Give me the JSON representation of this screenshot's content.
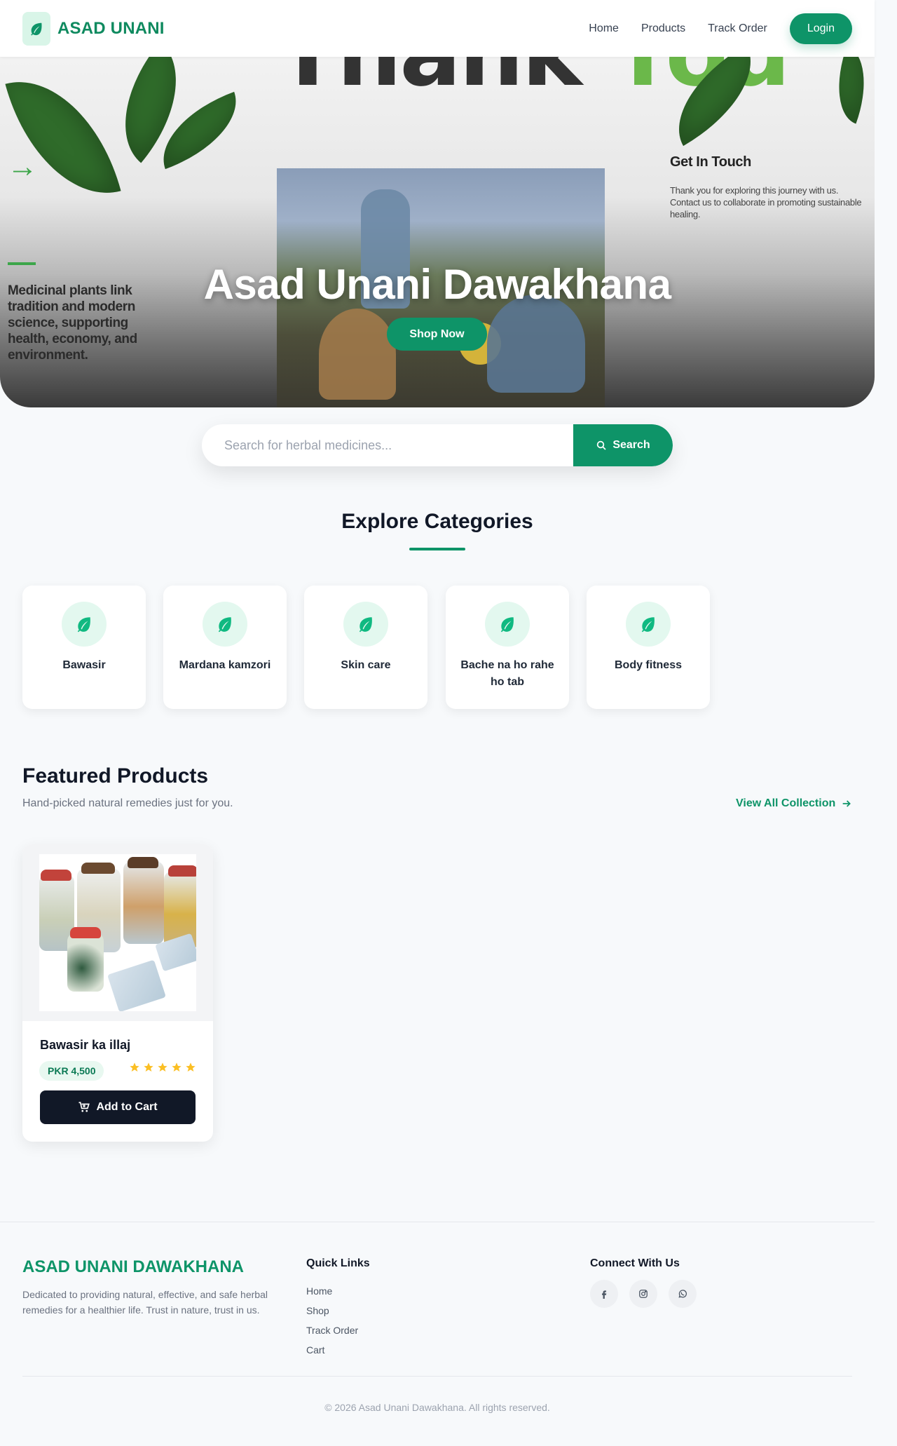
{
  "nav": {
    "brand": "ASAD UNANI",
    "links": [
      "Home",
      "Products",
      "Track Order"
    ],
    "login": "Login",
    "accent": "#0e9468"
  },
  "hero": {
    "banner_word1": "Thank",
    "banner_word2": "You",
    "left_text": "Medicinal plants link tradition and modern science, supporting health, economy, and environment.",
    "contact_title": "Get In Touch",
    "contact_text": "Thank you for exploring this journey with us. Contact us to collaborate in promoting sustainable healing.",
    "title": "Asad Unani Dawakhana",
    "cta": "Shop Now"
  },
  "search": {
    "placeholder": "Search for herbal medicines...",
    "button": "Search",
    "icon": "search-icon"
  },
  "categories": {
    "title": "Explore Categories",
    "items": [
      {
        "label": "Bawasir",
        "icon": "leaf-icon"
      },
      {
        "label": "Mardana kamzori",
        "icon": "leaf-icon"
      },
      {
        "label": "Skin care",
        "icon": "leaf-icon"
      },
      {
        "label": "Bache na ho rahe ho tab",
        "icon": "leaf-icon"
      },
      {
        "label": "Body fitness",
        "icon": "leaf-icon"
      }
    ]
  },
  "featured": {
    "title": "Featured Products",
    "subtitle": "Hand-picked natural remedies just for you.",
    "view_all": "View All Collection",
    "products": [
      {
        "name": "Bawasir ka illaj",
        "price": "PKR 4,500",
        "rating": 5,
        "add_to_cart": "Add to Cart"
      }
    ]
  },
  "footer": {
    "brand": "ASAD UNANI DAWAKHANA",
    "description": "Dedicated to providing natural, effective, and safe herbal remedies for a healthier life. Trust in nature, trust in us.",
    "quick_links_title": "Quick Links",
    "quick_links": [
      "Home",
      "Shop",
      "Track Order",
      "Cart"
    ],
    "connect_title": "Connect With Us",
    "social": [
      "facebook-icon",
      "instagram-icon",
      "whatsapp-icon"
    ],
    "copyright": "© 2026 Asad Unani Dawakhana. All rights reserved."
  }
}
